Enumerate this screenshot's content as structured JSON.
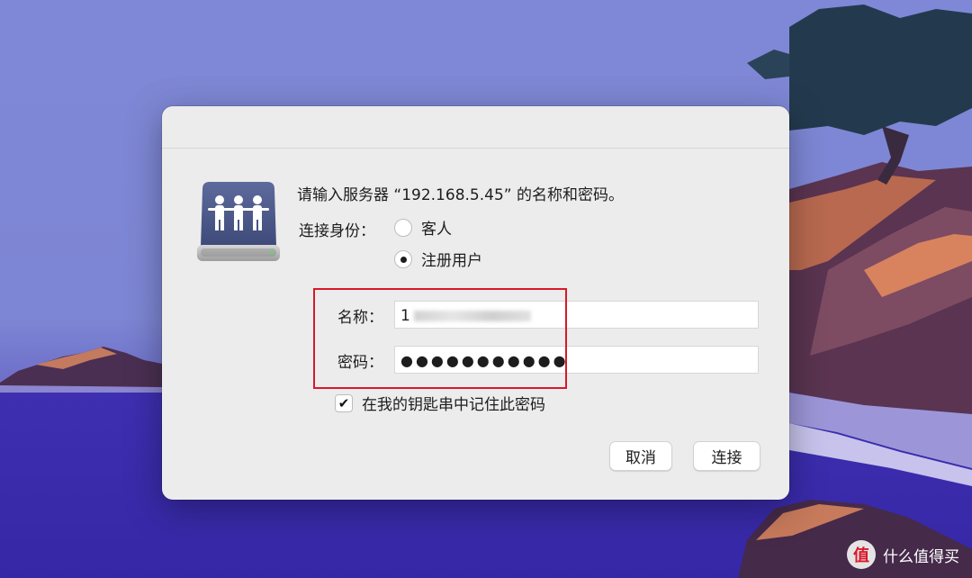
{
  "dialog": {
    "prompt": "请输入服务器 “192.168.5.45” 的名称和密码。",
    "connect_as_label": "连接身份：",
    "options": [
      {
        "label": "客人",
        "selected": false
      },
      {
        "label": "注册用户",
        "selected": true
      }
    ],
    "name_label": "名称：",
    "name_value": "1",
    "password_label": "密码：",
    "password_mask": "●●●●●●●●●●●",
    "remember_checked": true,
    "remember_label": "在我的钥匙串中记住此密码",
    "cancel_label": "取消",
    "connect_label": "连接"
  },
  "watermark": {
    "logo_text": "值",
    "text": "什么值得买"
  },
  "colors": {
    "highlight": "#d8192a",
    "dialog_bg": "#ececec"
  }
}
